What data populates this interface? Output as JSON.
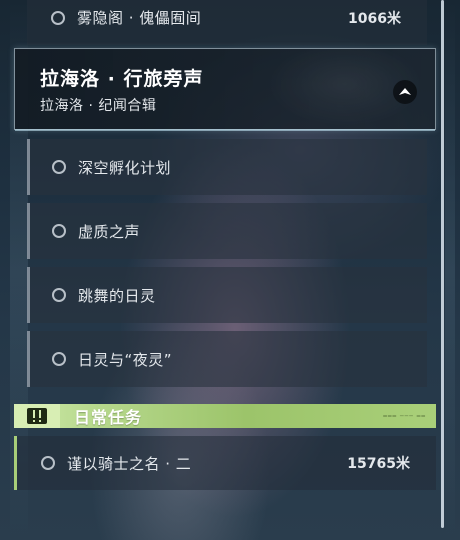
{
  "top_row": {
    "label": "雾隐阁 · 傀儡囿间",
    "distance": "1066米"
  },
  "quest_group": {
    "title": "拉海洛 · 行旅旁声",
    "subtitle": "拉海洛 · 纪闻合辑",
    "items": [
      {
        "label": "深空孵化计划"
      },
      {
        "label": "虚质之声"
      },
      {
        "label": "跳舞的日灵"
      },
      {
        "label": "日灵与“夜灵”"
      }
    ]
  },
  "daily": {
    "header_label": "日常任务",
    "items": [
      {
        "label": "谨以骑士之名 · 二",
        "distance": "15765米"
      }
    ]
  },
  "colors": {
    "accent_green": "#a9cf79",
    "panel_bg": "#242e3a"
  }
}
